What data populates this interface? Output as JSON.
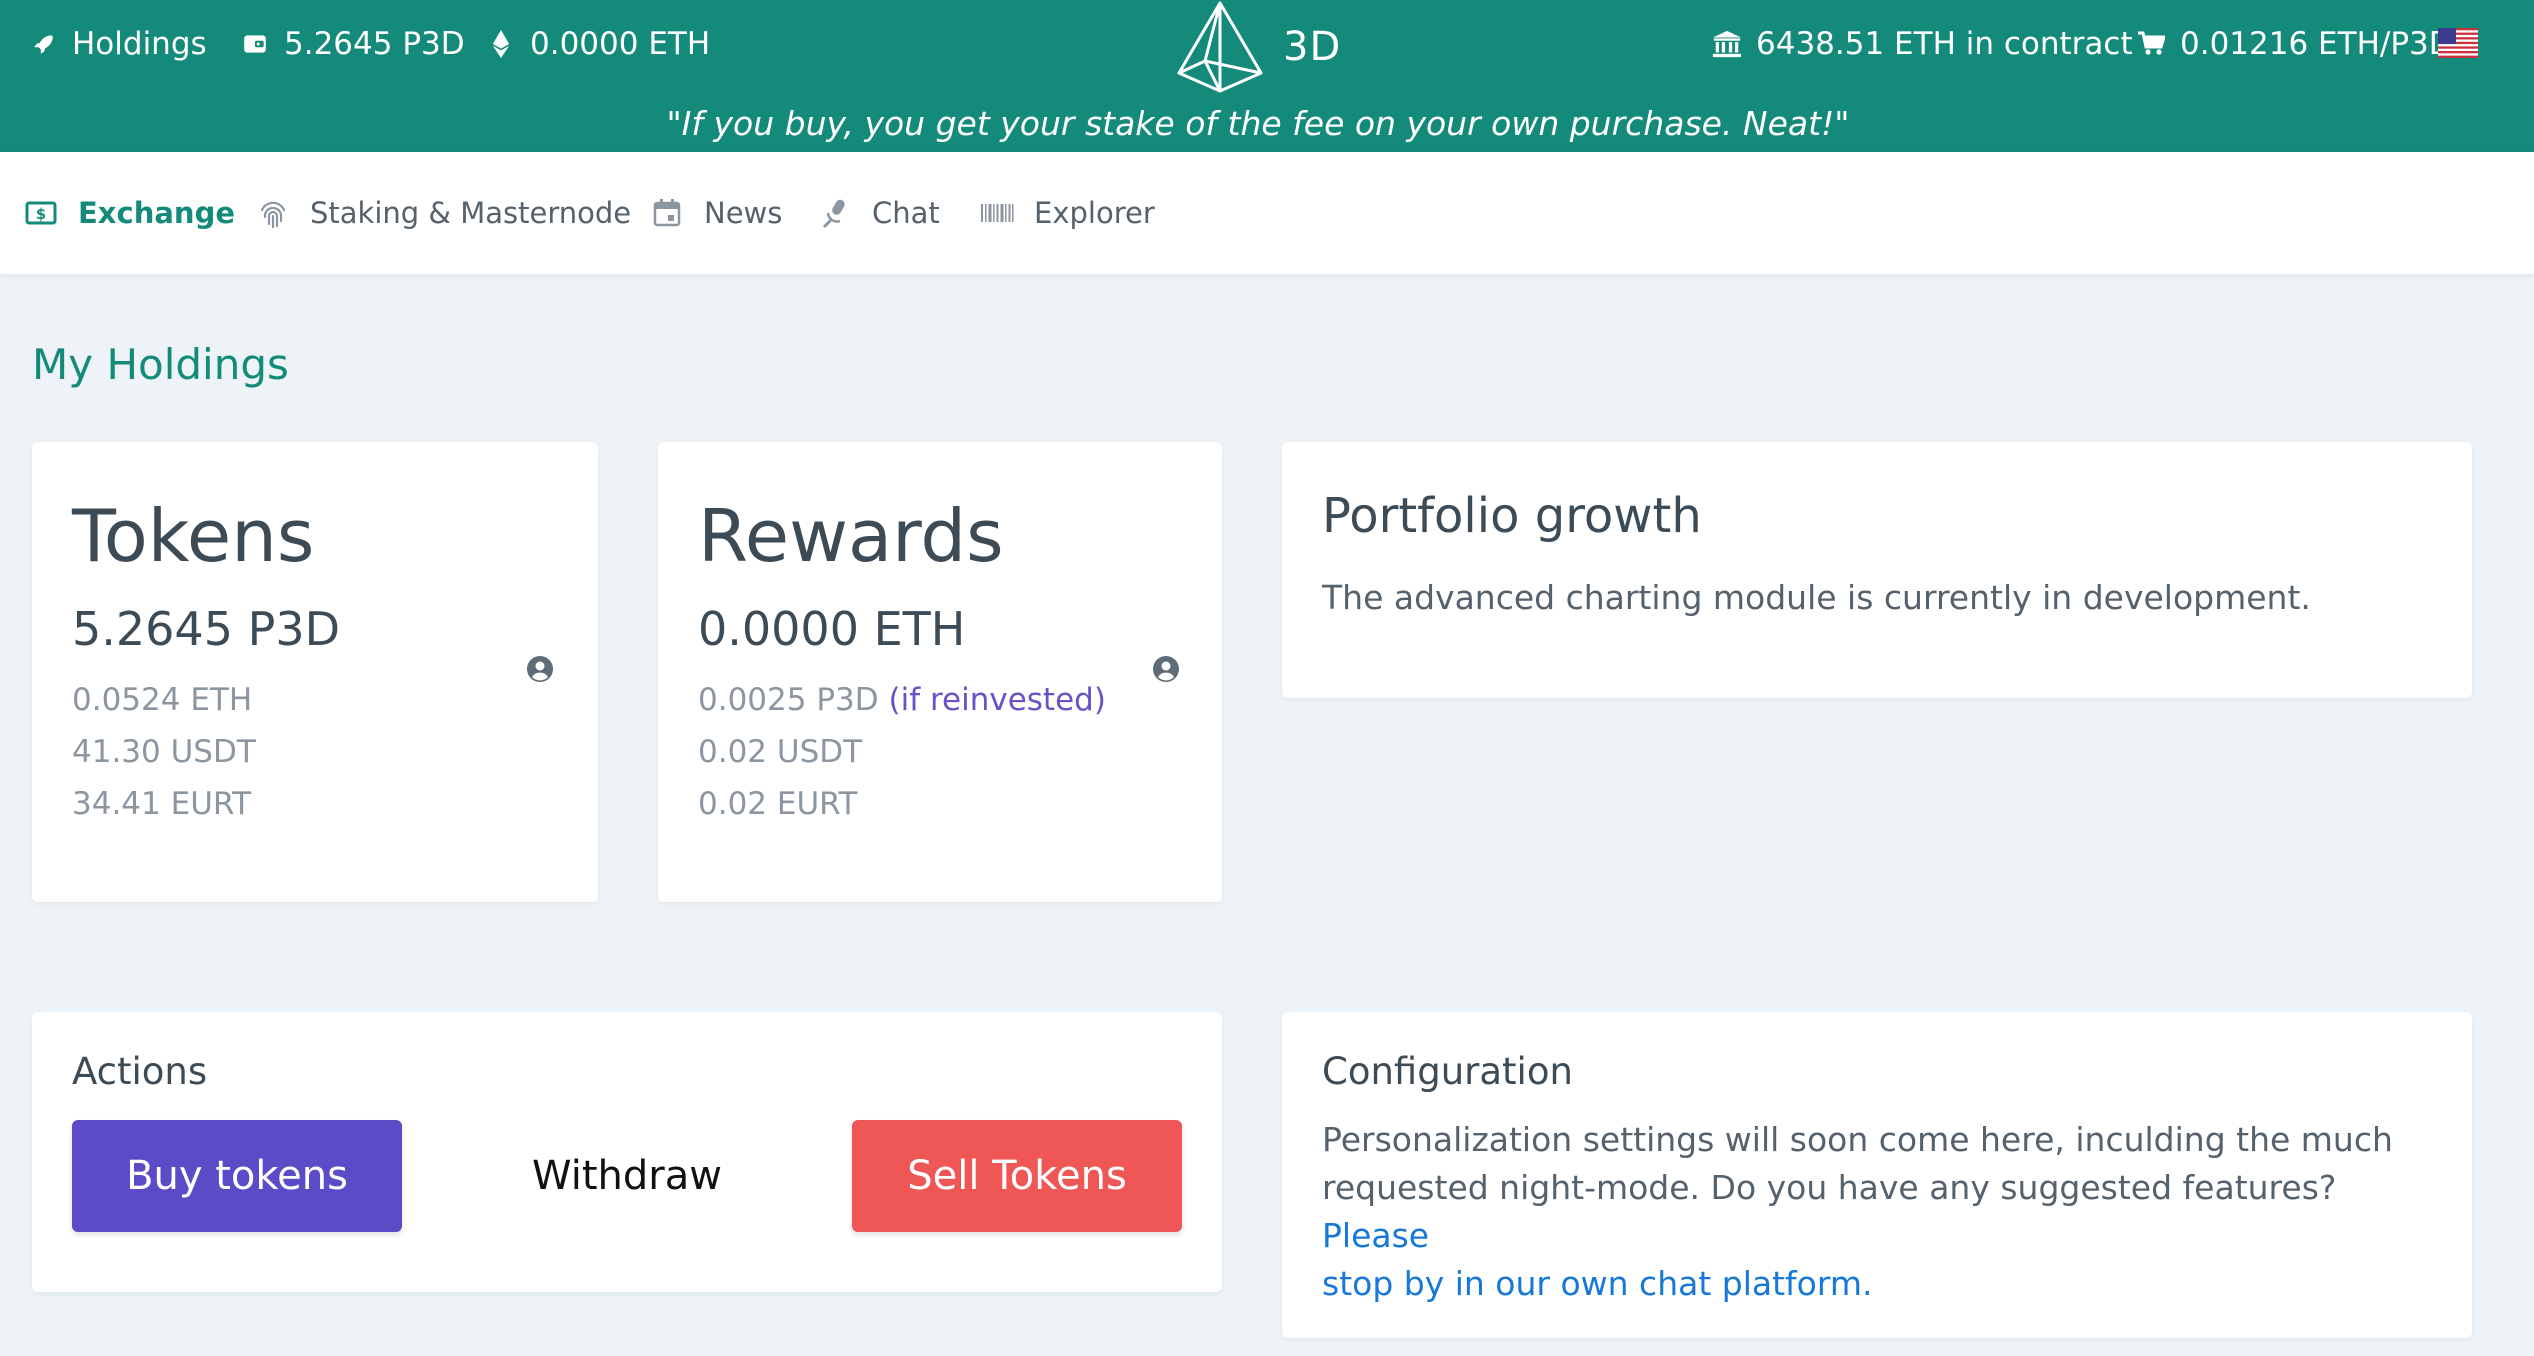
{
  "topbar": {
    "holdings_label": "Holdings",
    "p3d_balance": "5.2645 P3D",
    "eth_balance": "0.0000 ETH",
    "logo_text": "3D",
    "contract_eth": "6438.51 ETH in contract",
    "price": "0.01216 ETH/P3D",
    "tagline": "\"If you buy, you get your stake of the fee on your own purchase. Neat!\"",
    "language_flag": "us-flag-icon"
  },
  "nav": {
    "items": [
      {
        "label": "Exchange",
        "icon": "dollar-bill-icon",
        "active": true
      },
      {
        "label": "Staking & Masternode",
        "icon": "fingerprint-icon",
        "active": false
      },
      {
        "label": "News",
        "icon": "calendar-icon",
        "active": false
      },
      {
        "label": "Chat",
        "icon": "microphone-icon",
        "active": false
      },
      {
        "label": "Explorer",
        "icon": "barcode-icon",
        "active": false
      }
    ]
  },
  "main": {
    "section_title": "My Holdings",
    "tokens": {
      "title": "Tokens",
      "amount": "5.2645 P3D",
      "eth": "0.0524 ETH",
      "usdt": "41.30 USDT",
      "eurt": "34.41 EURT"
    },
    "rewards": {
      "title": "Rewards",
      "amount": "0.0000 ETH",
      "p3d": "0.0025 P3D",
      "reinvested": "(if reinvested)",
      "usdt": "0.02 USDT",
      "eurt": "0.02 EURT"
    },
    "portfolio": {
      "title": "Portfolio growth",
      "text": "The advanced charting module is currently in development."
    },
    "actions": {
      "title": "Actions",
      "buy": "Buy tokens",
      "withdraw": "Withdraw",
      "sell": "Sell Tokens"
    },
    "configuration": {
      "title": "Configuration",
      "text_line1": "Personalization settings will soon come here, inculding the much",
      "text_line2_plain": "requested night-mode. Do you have any suggested features? ",
      "text_line2_link": "Please",
      "text_line3_link": "stop by in our own chat platform."
    }
  },
  "colors": {
    "brand": "#148a7a",
    "buy": "#5c4bc6",
    "sell": "#ef5757",
    "link": "#1778d9",
    "reinvested": "#6a51c9"
  }
}
